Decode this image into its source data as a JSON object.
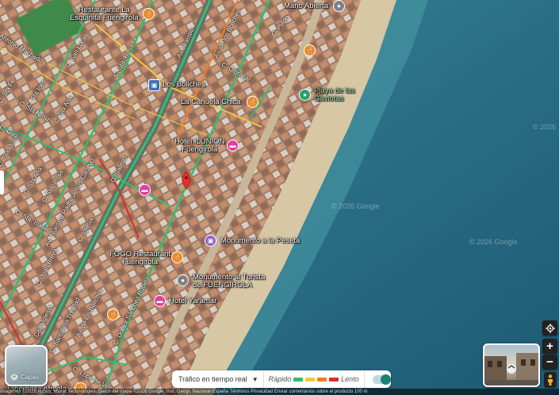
{
  "places": {
    "restaurante_esquinita": "Restaurante La\nEsquinita Fuengirola",
    "mano_abierta": "Mano Abierta",
    "los_boliches": "Los Boliches",
    "playa_gaviotas": "Playa de las\nGaviotas",
    "canuela_chica": "La Cañuela Chica",
    "hotel_ilunion": "Hotel ILUNION\nFuengirola",
    "monumento_peseta": "Monumento a la Peseta",
    "fogo": "FOGO Restaurant\nFuengirola",
    "monumento_turista": "Monumento al Turista\nde FUENGIROLA",
    "hotel_yaramar": "Hotel Yaramar",
    "taberna_abuela": "Taberna la Abuela"
  },
  "streets": {
    "antonio_machado": "Antonio Machado",
    "san_lucas": "C. San Lucas",
    "santa_rosa": "C. Sta. Rosa",
    "av_nuestro": "Av. Nuestro",
    "av_boliches": "Av. de los Boliches",
    "c_pulpo": "C. Pulpo",
    "c_gibraltar": "C. Gibraltar",
    "c_stafe": "C. Sta Fe",
    "c_inés": "C. Sta Inés",
    "c_cruz": "C. Sta. Cruz",
    "c_ana": "C. Sta Ana",
    "c_camo": "C. Camo",
    "c_julia": "C. Sta. Julia",
    "c_ana2": "C. Sta Ana",
    "c_sta_isabel": "C. Sta. Isabel",
    "c_rosa2": "C. Sta. Rosa",
    "av_padre_jesus": "Av. Nuestro Padre Jesús Cautivo",
    "c_salinas": "C. Salinas",
    "c_iglesia": "C. Iglesia",
    "c_juan_breva": "C. Juan Breva",
    "calle_iglesia": "Calle Iglesia",
    "c_santisima": "C. Santísima Trinidad",
    "av_boliches2": "Av. de los Boliches",
    "c_doctor": "C. Doctor Sánchez Rubio",
    "c_lope": "C. Lope de Vega"
  },
  "watermarks": [
    "© 2026 Google",
    "© 2026 Google",
    "© 2026"
  ],
  "controls": {
    "layers_label": "Capas",
    "traffic_select": "Tráfico en tiempo real",
    "fast_label": "Rápido",
    "slow_label": "Lento",
    "zoom_in": "+",
    "zoom_out": "−"
  },
  "attribution": "Imágenes ©2026 Airbus, Maxar Technologies, Datos del mapa ©2026 Google, Inst. Geogr. Nacional    España    Términos    Privacidad    Enviar comentarios sobre el producto    100 m",
  "colors": {
    "traffic_fast": "#2fbf71",
    "traffic_mid": "#f5c542",
    "traffic_slow1": "#f07e26",
    "traffic_slow2": "#d33131",
    "sea": "#2c6f86",
    "sand": "#d8c7a5"
  }
}
